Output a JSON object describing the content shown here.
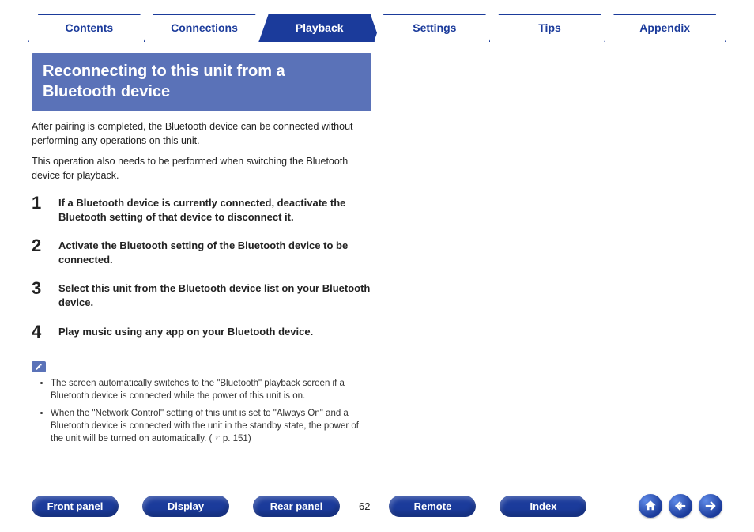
{
  "tabs": {
    "items": [
      {
        "label": "Contents",
        "active": false
      },
      {
        "label": "Connections",
        "active": false
      },
      {
        "label": "Playback",
        "active": true
      },
      {
        "label": "Settings",
        "active": false
      },
      {
        "label": "Tips",
        "active": false
      },
      {
        "label": "Appendix",
        "active": false
      }
    ]
  },
  "heading": "Reconnecting to this unit from a Bluetooth device",
  "intro": {
    "p1": "After pairing is completed, the Bluetooth device can be connected without performing any operations on this unit.",
    "p2": "This operation also needs to be performed when switching the Bluetooth device for playback."
  },
  "steps": [
    {
      "num": "1",
      "text": "If a Bluetooth device is currently connected, deactivate the Bluetooth setting of that device to disconnect it."
    },
    {
      "num": "2",
      "text": "Activate the Bluetooth setting of the Bluetooth device to be connected."
    },
    {
      "num": "3",
      "text": "Select this unit from the Bluetooth device list on your Bluetooth device."
    },
    {
      "num": "4",
      "text": "Play music using any app on your Bluetooth device."
    }
  ],
  "notes": {
    "b1": "The screen automatically switches to the \"Bluetooth\" playback screen if a Bluetooth device is connected while the power of this unit is on.",
    "b2": "When the \"Network Control\" setting of this unit is set to \"Always On\" and a Bluetooth device is connected with the unit in the standby state, the power of the unit will be turned on automatically.  (☞ p. 151)"
  },
  "bottom": {
    "front": "Front panel",
    "display": "Display",
    "rear": "Rear panel",
    "remote": "Remote",
    "index": "Index",
    "page": "62"
  }
}
